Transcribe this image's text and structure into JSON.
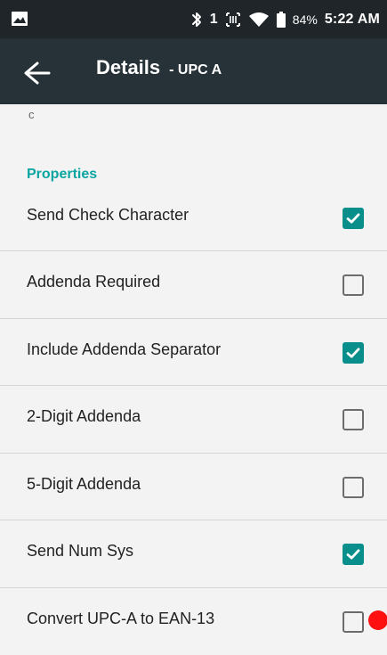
{
  "status_bar": {
    "battery_percent": "84%",
    "time": "5:22 AM",
    "sim_label": "1",
    "icons": [
      "image-icon",
      "bluetooth-icon",
      "sim-icon",
      "barcode-icon",
      "wifi-icon",
      "battery-icon"
    ]
  },
  "app_bar": {
    "title": "Details",
    "subtitle": "- UPC A"
  },
  "content": {
    "cut_text": "c",
    "section_title": "Properties",
    "items": [
      {
        "label": "Send Check Character",
        "checked": true
      },
      {
        "label": "Addenda Required",
        "checked": false
      },
      {
        "label": "Include Addenda Separator",
        "checked": true
      },
      {
        "label": "2-Digit Addenda",
        "checked": false
      },
      {
        "label": "5-Digit Addenda",
        "checked": false
      },
      {
        "label": "Send Num Sys",
        "checked": true
      },
      {
        "label": "Convert UPC-A to EAN-13",
        "checked": false
      }
    ]
  },
  "colors": {
    "status_bar": "#1f2528",
    "app_bar": "#263238",
    "accent": "#088f8b",
    "section_text": "#0aa5a1",
    "background": "#f3f3f3"
  }
}
